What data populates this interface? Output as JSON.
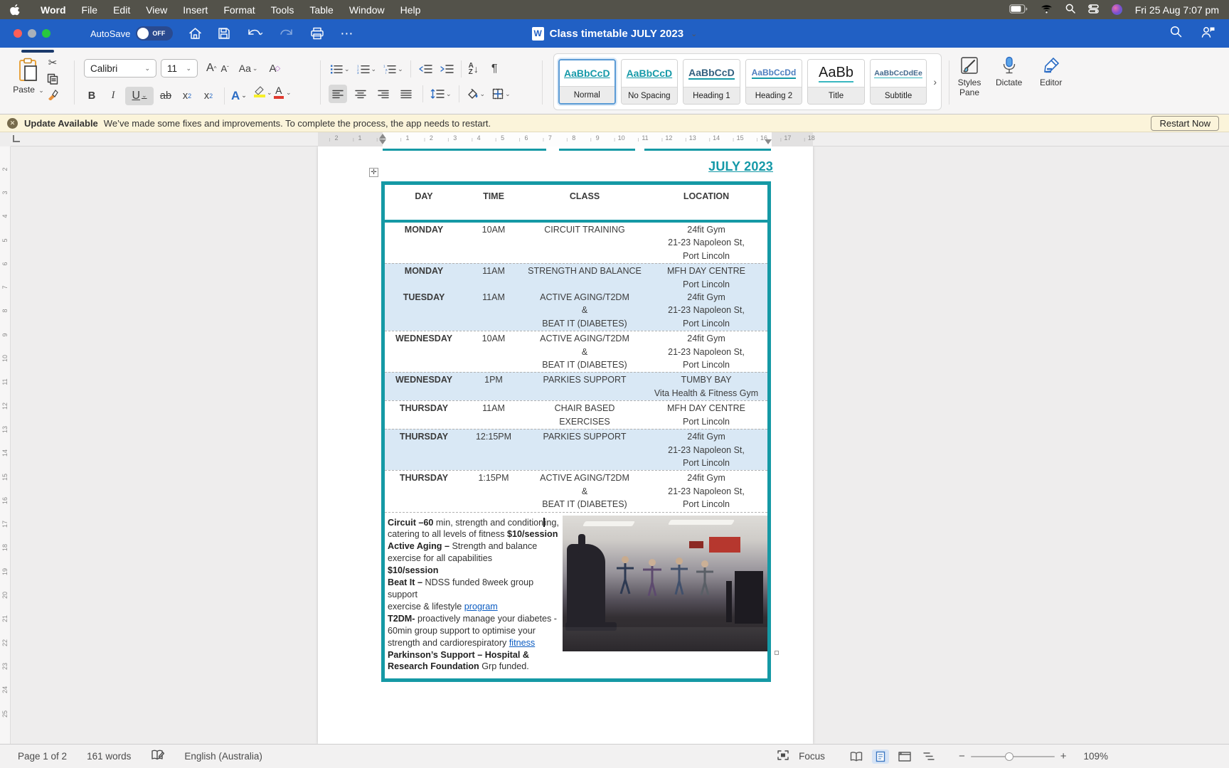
{
  "menubar": {
    "app_name": "Word",
    "items": [
      "File",
      "Edit",
      "View",
      "Insert",
      "Format",
      "Tools",
      "Table",
      "Window",
      "Help"
    ],
    "clock": "Fri 25 Aug 7:07 pm"
  },
  "titlebar": {
    "autosave_label": "AutoSave",
    "autosave_state": "OFF",
    "doc_title": "Class timetable JULY 2023",
    "doc_icon_letter": "W"
  },
  "ribbon": {
    "paste_label": "Paste",
    "font_name": "Calibri",
    "font_size": "11",
    "styles": [
      {
        "preview": "AaBbCcD",
        "label": "Normal"
      },
      {
        "preview": "AaBbCcD",
        "label": "No Spacing"
      },
      {
        "preview": "AaBbCcD",
        "label": "Heading 1"
      },
      {
        "preview": "AaBbCcDd",
        "label": "Heading 2"
      },
      {
        "preview": "AaBb",
        "label": "Title"
      },
      {
        "preview": "AaBbCcDdEe",
        "label": "Subtitle"
      }
    ],
    "styles_pane_label": "Styles Pane",
    "dictate_label": "Dictate",
    "editor_label": "Editor"
  },
  "banner": {
    "title": "Update Available",
    "message": "We’ve made some fixes and improvements. To complete the process, the app needs to restart.",
    "button": "Restart Now"
  },
  "ruler": {
    "h_numbers": [
      "2",
      "1",
      "1",
      "2",
      "3",
      "4",
      "5",
      "6",
      "7",
      "8",
      "9",
      "10",
      "11",
      "12",
      "13",
      "14",
      "15",
      "16",
      "17",
      "18"
    ],
    "v_numbers": [
      "2",
      "3",
      "4",
      "5",
      "6",
      "7",
      "8",
      "9",
      "10",
      "11",
      "12",
      "13",
      "14",
      "15",
      "16",
      "17",
      "18",
      "19",
      "20",
      "21",
      "22",
      "23",
      "24",
      "25"
    ]
  },
  "document": {
    "title": "JULY 2023",
    "table": {
      "headers": [
        "DAY",
        "TIME",
        "CLASS",
        "LOCATION"
      ],
      "rows": [
        {
          "shaded": false,
          "entries": [
            {
              "day": "MONDAY",
              "time": "10AM",
              "class_lines": [
                "CIRCUIT TRAINING"
              ],
              "location_lines": [
                "24fit Gym",
                "21-23 Napoleon St,",
                "Port Lincoln"
              ]
            }
          ]
        },
        {
          "shaded": true,
          "entries": [
            {
              "day": "MONDAY",
              "time": "11AM",
              "class_lines": [
                "STRENGTH AND BALANCE"
              ],
              "location_lines": [
                "MFH DAY CENTRE",
                "Port Lincoln"
              ]
            },
            {
              "day": "TUESDAY",
              "time": "11AM",
              "class_lines": [
                "ACTIVE AGING/T2DM",
                "&",
                "BEAT IT (DIABETES)"
              ],
              "location_lines": [
                "24fit Gym",
                "21-23 Napoleon St,",
                "Port Lincoln"
              ]
            }
          ]
        },
        {
          "shaded": false,
          "entries": [
            {
              "day": "WEDNESDAY",
              "time": "10AM",
              "class_lines": [
                "ACTIVE AGING/T2DM",
                "&",
                "BEAT IT (DIABETES)"
              ],
              "location_lines": [
                "24fit Gym",
                "21-23 Napoleon St,",
                "Port Lincoln"
              ]
            }
          ]
        },
        {
          "shaded": true,
          "entries": [
            {
              "day": "WEDNESDAY",
              "time": "1PM",
              "class_lines": [
                "PARKIES SUPPORT"
              ],
              "location_lines": [
                "TUMBY BAY",
                "Vita Health & Fitness Gym"
              ]
            }
          ]
        },
        {
          "shaded": false,
          "entries": [
            {
              "day": "THURSDAY",
              "time": "11AM",
              "class_lines": [
                "CHAIR BASED",
                "EXERCISES"
              ],
              "location_lines": [
                "MFH DAY CENTRE",
                "Port Lincoln"
              ]
            }
          ]
        },
        {
          "shaded": true,
          "entries": [
            {
              "day": "THURSDAY",
              "time": "12:15PM",
              "class_lines": [
                "PARKIES SUPPORT"
              ],
              "location_lines": [
                "24fit Gym",
                "21-23 Napoleon St,",
                "Port Lincoln"
              ]
            }
          ]
        },
        {
          "shaded": false,
          "entries": [
            {
              "day": "THURSDAY",
              "time": "1:15PM",
              "class_lines": [
                "ACTIVE AGING/T2DM",
                "&",
                "BEAT IT (DIABETES)"
              ],
              "location_lines": [
                "24fit Gym",
                "21-23 Napoleon St,",
                "Port Lincoln"
              ]
            }
          ]
        }
      ]
    },
    "description": {
      "l1a": "Circuit –60",
      "l1b": " min, strength and condition",
      "l1c": "ing,",
      "l2a": "catering to all levels of fitness ",
      "l2b": "$10/session",
      "l3a": "Active Aging – ",
      "l3b": "Strength and balance",
      "l4": "exercise for all capabilities",
      "l5": "$10/session",
      "l6a": "Beat It – ",
      "l6b": "NDSS funded 8week group support",
      "l7a": "exercise & lifestyle ",
      "l7b": "program",
      "l8a": "T2DM-",
      "l8b": " proactively manage your diabetes -",
      "l9": "60min group support to optimise your",
      "l10a": "strength and cardiorespiratory ",
      "l10b": "fitness",
      "l11": "Parkinson’s Support – Hospital &",
      "l12a": "Research Foundation",
      "l12b": " Grp funded."
    }
  },
  "statusbar": {
    "page": "Page 1 of 2",
    "words": "161 words",
    "language": "English (Australia)",
    "focus_label": "Focus",
    "zoom": "109%"
  },
  "colors": {
    "teal": "#1599a5",
    "row_blue": "#d9e8f5",
    "titlebar_blue": "#2160c4",
    "link_blue": "#0b5cc2",
    "banner_beige": "#fbf4da"
  }
}
